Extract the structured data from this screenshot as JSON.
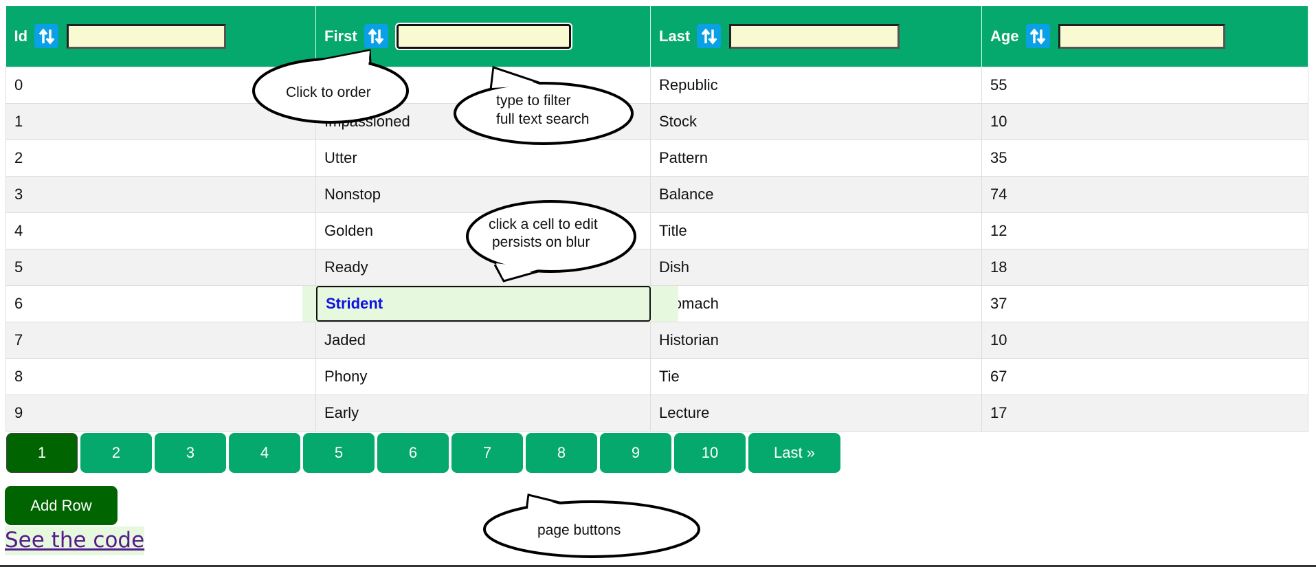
{
  "colors": {
    "header": "#05a86d",
    "sort_icon": "#0aa0e6",
    "filter_bg": "#fafad2",
    "active_page": "#006400",
    "edit_bg": "#e6f9df",
    "edit_text": "#1010e0"
  },
  "columns": [
    {
      "label": "Id",
      "icon": "sort-refresh-icon",
      "filter_value": ""
    },
    {
      "label": "First",
      "icon": "sort-refresh-icon",
      "filter_value": ""
    },
    {
      "label": "Last",
      "icon": "sort-refresh-icon",
      "filter_value": ""
    },
    {
      "label": "Age",
      "icon": "sort-refresh-icon",
      "filter_value": ""
    }
  ],
  "rows": [
    [
      "0",
      "",
      "Republic",
      "55"
    ],
    [
      "1",
      "Impassioned",
      "Stock",
      "10"
    ],
    [
      "2",
      "Utter",
      "Pattern",
      "35"
    ],
    [
      "3",
      "Nonstop",
      "Balance",
      "74"
    ],
    [
      "4",
      "Golden",
      "Title",
      "12"
    ],
    [
      "5",
      "Ready",
      "Dish",
      "18"
    ],
    [
      "6",
      "",
      "Stomach",
      "37"
    ],
    [
      "7",
      "Jaded",
      "Historian",
      "10"
    ],
    [
      "8",
      "Phony",
      "Tie",
      "67"
    ],
    [
      "9",
      "Early",
      "Lecture",
      "17"
    ]
  ],
  "editing": {
    "value": "Strident"
  },
  "pages": [
    "1",
    "2",
    "3",
    "4",
    "5",
    "6",
    "7",
    "8",
    "9",
    "10"
  ],
  "active_page": "1",
  "last_label": "Last »",
  "add_row_label": "Add Row",
  "code_link": "See the code",
  "callouts": {
    "order": "Click to order",
    "filter_1": "type to filter",
    "filter_2": "full text search",
    "edit_1": "click a cell to edit",
    "edit_2": "persists on blur",
    "pages": "page buttons"
  }
}
